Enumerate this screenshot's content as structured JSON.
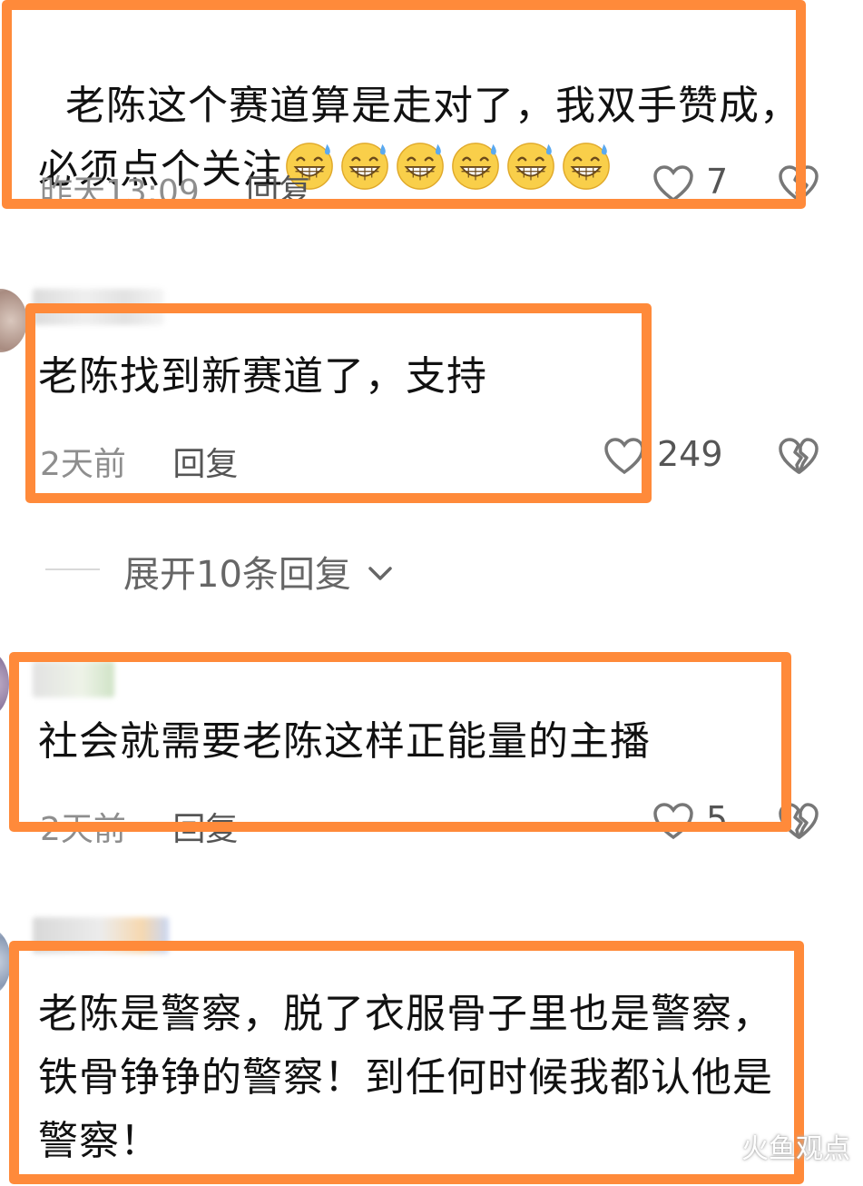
{
  "comments": [
    {
      "text": "老陈这个赛道算是走对了，我双手赞成，必须点个关注",
      "emoji_count": 6,
      "time": "昨天13:09",
      "reply": "回复",
      "likes": "7"
    },
    {
      "text": "老陈找到新赛道了，支持",
      "time": "2天前",
      "reply": "回复",
      "likes": "249"
    },
    {
      "text": "社会就需要老陈这样正能量的主播",
      "time": "2天前",
      "reply": "回复",
      "likes": "5"
    },
    {
      "text": "老陈是警察，脱了衣服骨子里也是警察，铁骨铮铮的警察！到任何时候我都认他是警察！"
    }
  ],
  "expand_replies": {
    "label": "展开10条回复"
  },
  "watermark": "火鱼观点",
  "colors": {
    "highlight": "#ff8a3a",
    "meta": "#8e8e8e",
    "text": "#111111"
  },
  "icons": [
    "heart-outline-icon",
    "broken-heart-icon",
    "chevron-down-icon",
    "grinning-sweat-emoji"
  ]
}
